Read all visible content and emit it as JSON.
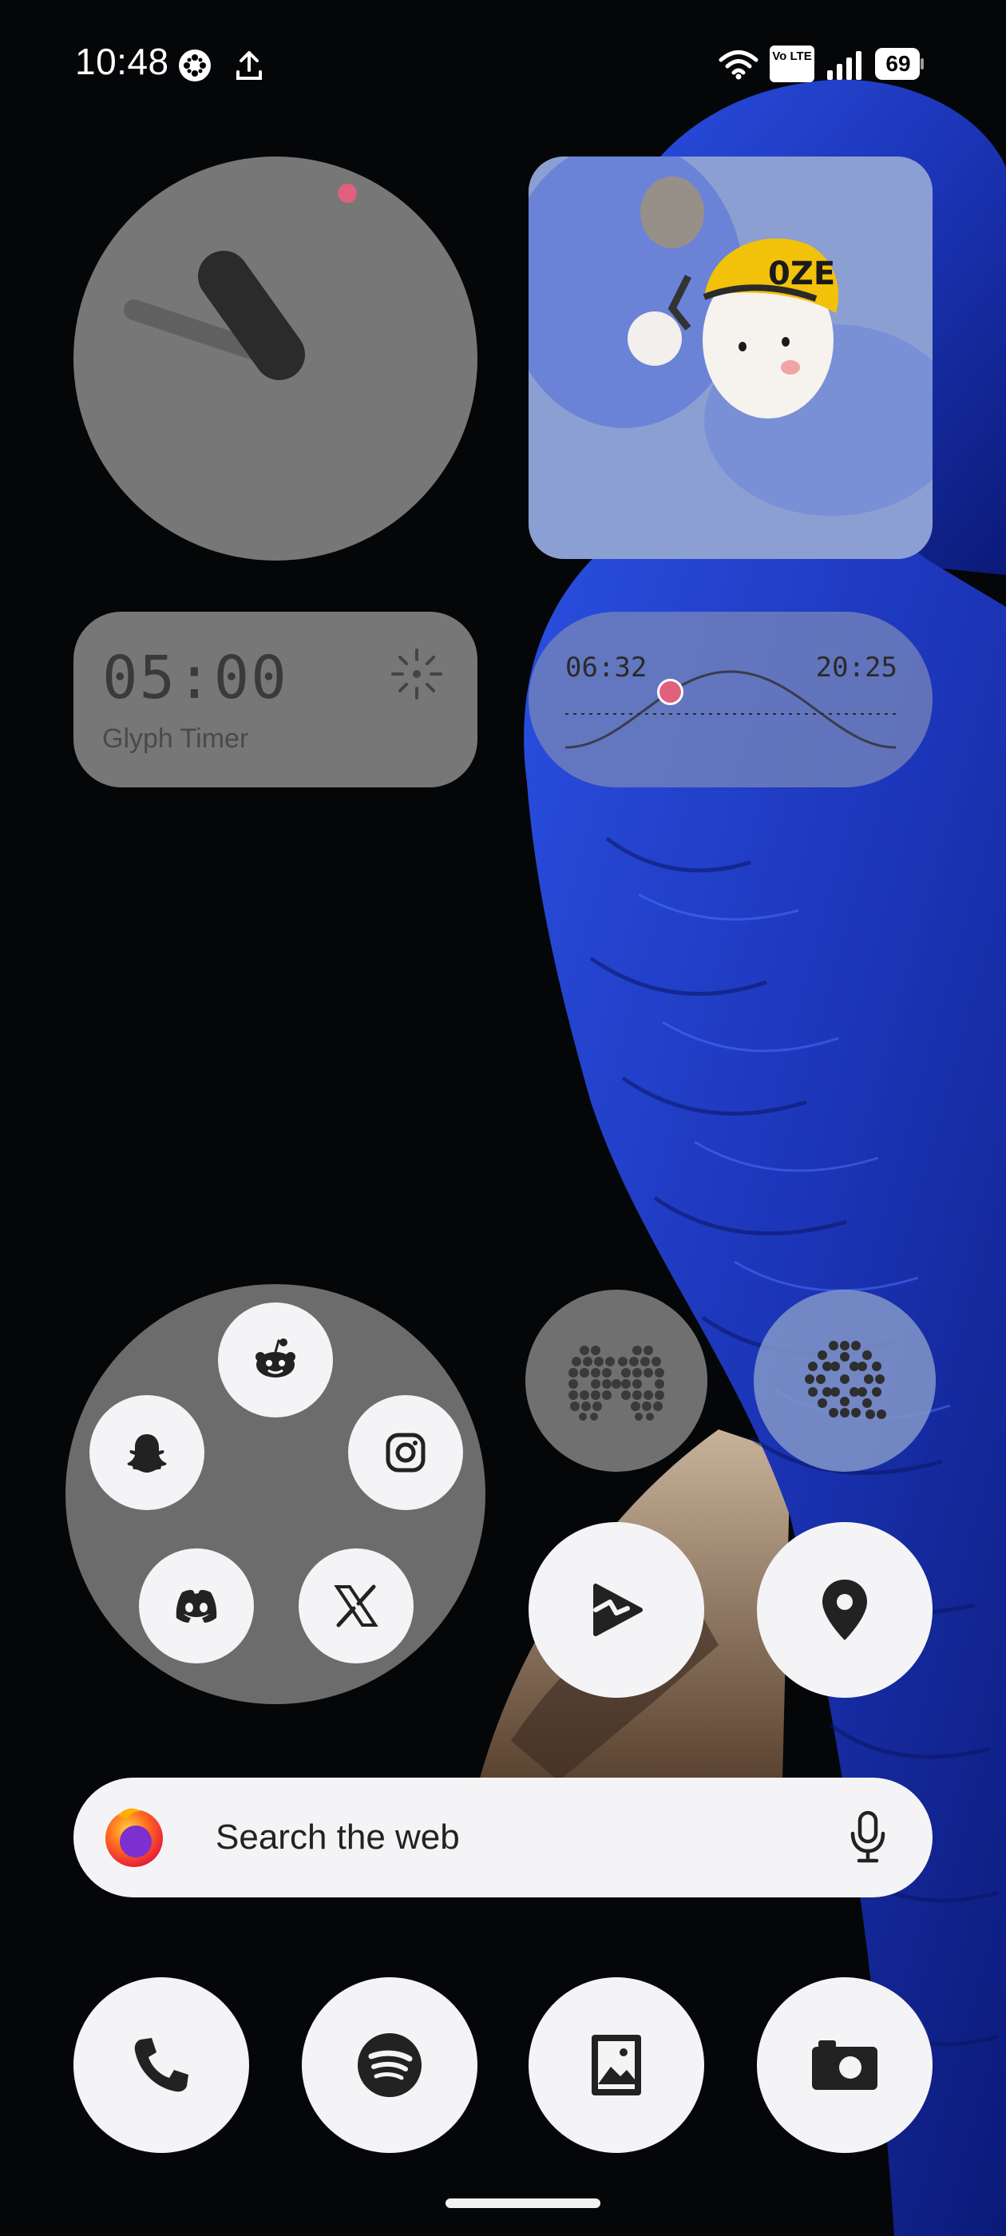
{
  "status_bar": {
    "time": "10:48",
    "volte_label": "Vo LTE",
    "battery": "69",
    "icons": [
      "pinwheel-icon",
      "upload-icon",
      "wifi-icon",
      "volte-icon",
      "signal-icon",
      "battery-icon"
    ]
  },
  "widgets": {
    "clock": {
      "type": "analog-clock"
    },
    "photo": {
      "icon": "mascot-photo"
    },
    "timer": {
      "time": "05:00",
      "label": "Glyph Timer",
      "icon": "sun-burst-icon"
    },
    "sun": {
      "sunrise": "06:32",
      "sunset": "20:25",
      "progress": 0.33,
      "accent": "#e0607e"
    }
  },
  "folder": {
    "apps": [
      "reddit-icon",
      "snapchat-icon",
      "instagram-icon",
      "discord-icon",
      "x-icon"
    ]
  },
  "shortcuts": [
    "games-icon",
    "film-reel-icon",
    "play-games-icon",
    "maps-pin-icon"
  ],
  "search": {
    "placeholder": "Search the web",
    "icons": [
      "firefox-icon",
      "mic-icon"
    ]
  },
  "dock": [
    "phone-icon",
    "spotify-icon",
    "gallery-icon",
    "camera-icon"
  ],
  "colors": {
    "widget_gray": "#777777",
    "accent_pink": "#e0607e",
    "bubble_white": "#f4f4f6",
    "parrot_blue": "#1f3fc4"
  }
}
